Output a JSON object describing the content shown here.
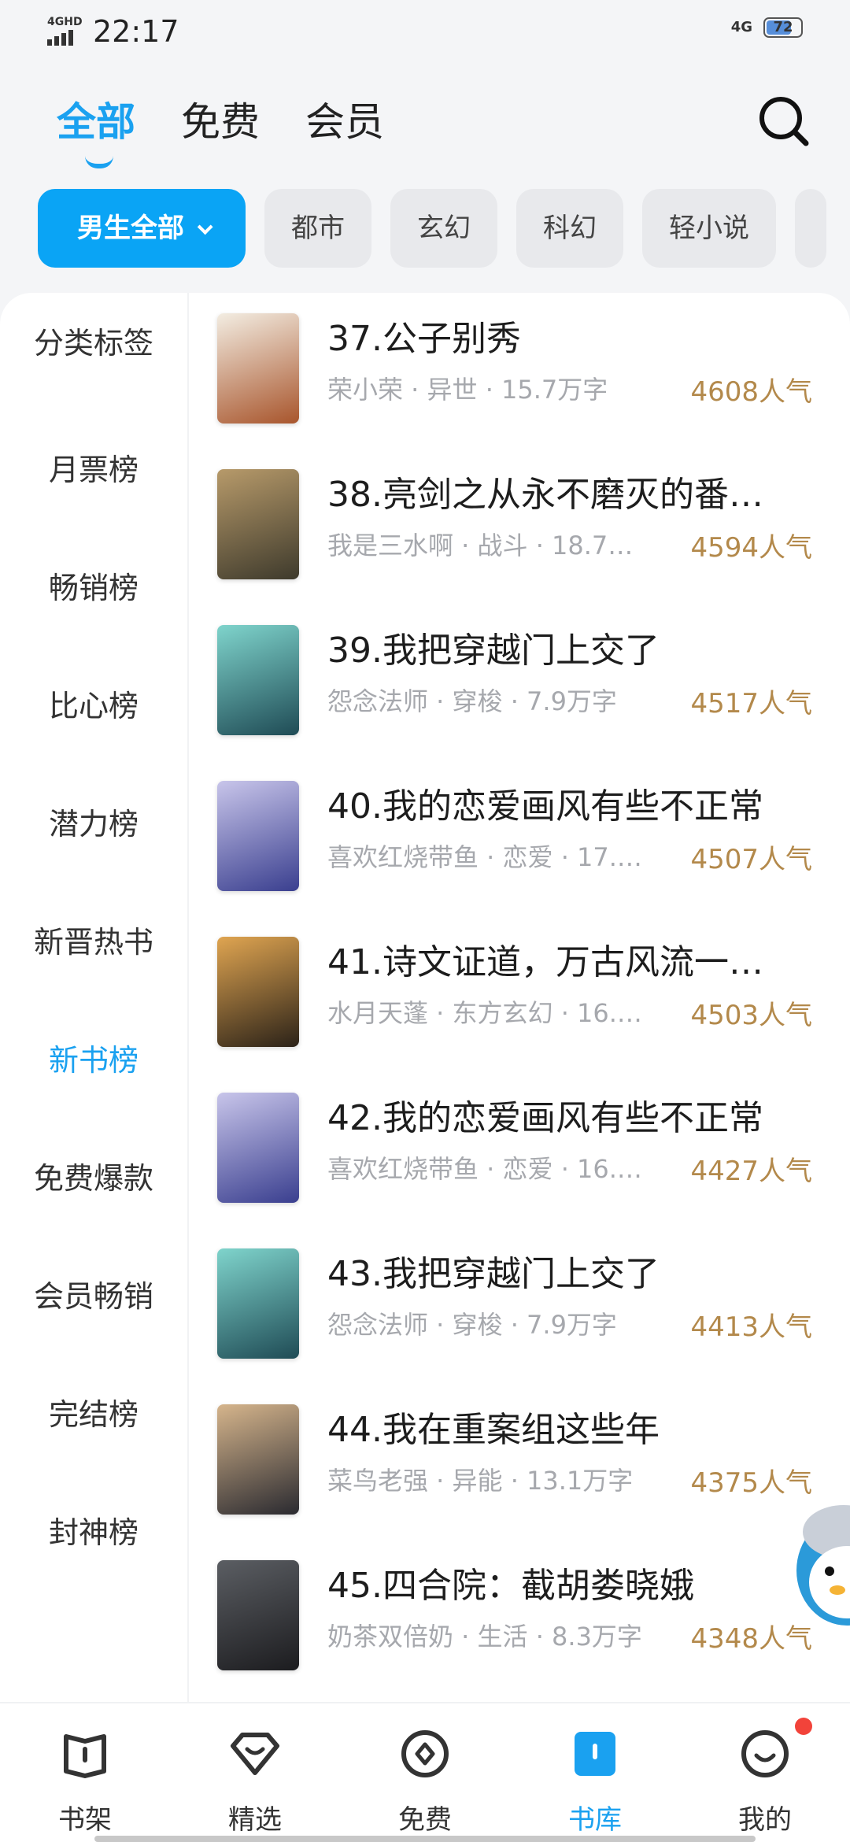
{
  "status_bar": {
    "network_tag": "4GHD",
    "time": "22:17",
    "network_right": "4G",
    "battery": "72"
  },
  "top_tabs": [
    {
      "label": "全部",
      "active": true
    },
    {
      "label": "免费",
      "active": false
    },
    {
      "label": "会员",
      "active": false
    }
  ],
  "search_icon": "search-icon",
  "chips": [
    {
      "label": "男生全部",
      "primary": true
    },
    {
      "label": "都市"
    },
    {
      "label": "玄幻"
    },
    {
      "label": "科幻"
    },
    {
      "label": "轻小说"
    }
  ],
  "left_nav": [
    {
      "label": "分类标签"
    },
    {
      "label": "月票榜"
    },
    {
      "label": "畅销榜"
    },
    {
      "label": "比心榜"
    },
    {
      "label": "潜力榜"
    },
    {
      "label": "新晋热书"
    },
    {
      "label": "新书榜",
      "active": true
    },
    {
      "label": "免费爆款"
    },
    {
      "label": "会员畅销"
    },
    {
      "label": "完结榜"
    },
    {
      "label": "封神榜"
    }
  ],
  "books": [
    {
      "title": "37.公子别秀",
      "meta": "荣小荣 · 异世 · 15.7万字",
      "popularity": "4608人气",
      "cover_colors": [
        "#f3ede2",
        "#a8552c"
      ]
    },
    {
      "title": "38.亮剑之从永不磨灭的番…",
      "meta": "我是三水啊 · 战斗 · 18.7…",
      "popularity": "4594人气",
      "cover_colors": [
        "#b79a6a",
        "#3e3a2c"
      ]
    },
    {
      "title": "39.我把穿越门上交了",
      "meta": "怨念法师 · 穿梭 · 7.9万字",
      "popularity": "4517人气",
      "cover_colors": [
        "#7fd4cc",
        "#1f4b55"
      ]
    },
    {
      "title": "40.我的恋爱画风有些不正常",
      "meta": "喜欢红烧带鱼 · 恋爱 · 17.…",
      "popularity": "4507人气",
      "cover_colors": [
        "#c8c5ea",
        "#3a3f8f"
      ]
    },
    {
      "title": "41.诗文证道，万古风流一…",
      "meta": "水月天蓬 · 东方玄幻 · 16.…",
      "popularity": "4503人气",
      "cover_colors": [
        "#e0a551",
        "#2b2218"
      ]
    },
    {
      "title": "42.我的恋爱画风有些不正常",
      "meta": "喜欢红烧带鱼 · 恋爱 · 16.…",
      "popularity": "4427人气",
      "cover_colors": [
        "#c8c5ea",
        "#3a3f8f"
      ]
    },
    {
      "title": "43.我把穿越门上交了",
      "meta": "怨念法师 · 穿梭 · 7.9万字",
      "popularity": "4413人气",
      "cover_colors": [
        "#7fd4cc",
        "#1f4b55"
      ]
    },
    {
      "title": "44.我在重案组这些年",
      "meta": "菜鸟老强 · 异能 · 13.1万字",
      "popularity": "4375人气",
      "cover_colors": [
        "#d6b58c",
        "#2a2a30"
      ]
    },
    {
      "title": "45.四合院：截胡娄晓娥",
      "meta": "奶茶双倍奶 · 生活 · 8.3万字",
      "popularity": "4348人气",
      "cover_colors": [
        "#5b5e63",
        "#1c1c1f"
      ]
    }
  ],
  "bottom_nav": [
    {
      "label": "书架",
      "icon": "bookshelf-icon"
    },
    {
      "label": "精选",
      "icon": "featured-icon"
    },
    {
      "label": "免费",
      "icon": "free-icon"
    },
    {
      "label": "书库",
      "icon": "library-icon",
      "active": true
    },
    {
      "label": "我的",
      "icon": "profile-icon"
    }
  ],
  "colors": {
    "accent": "#1aa1f0",
    "popularity": "#b3894b",
    "badge": "#f2433a"
  }
}
